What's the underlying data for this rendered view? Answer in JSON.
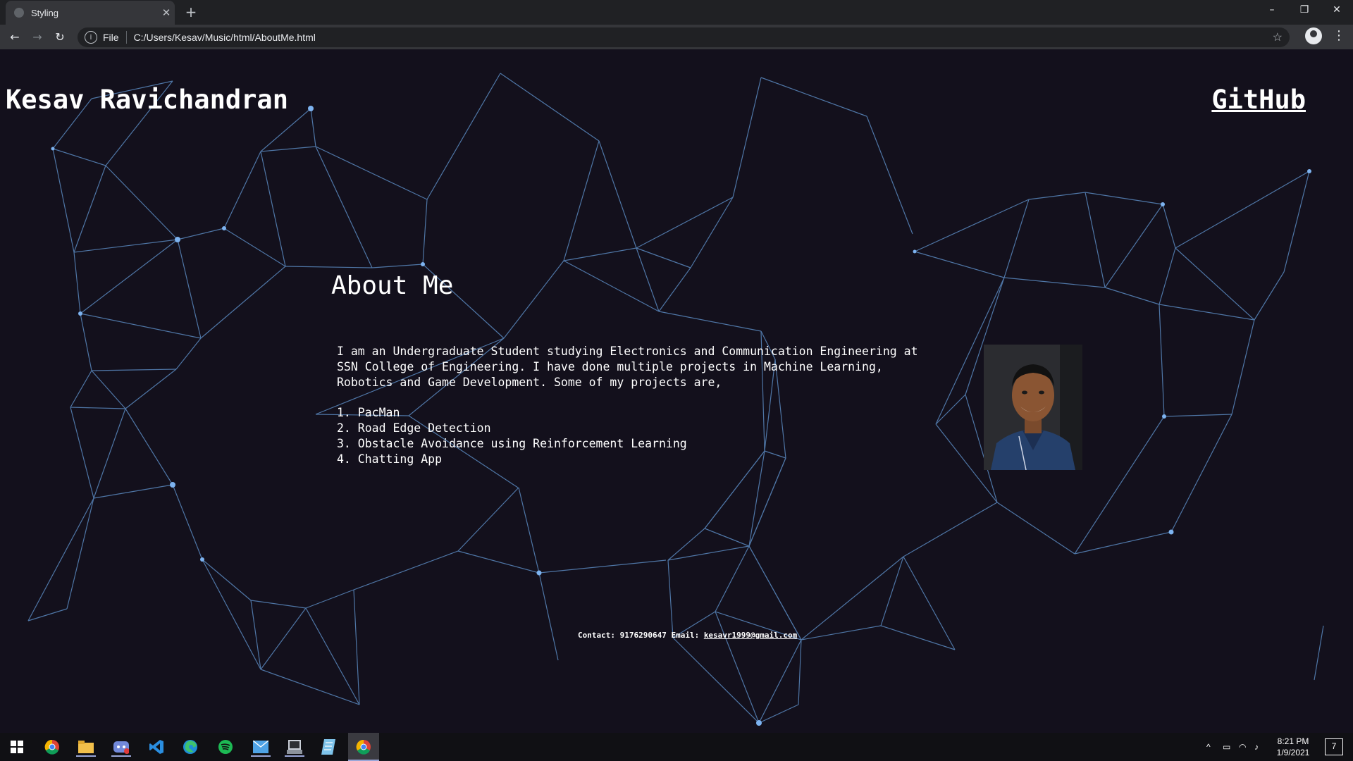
{
  "browser": {
    "tab_title": "Styling",
    "address_protocol": "File",
    "address_url": "C:/Users/Kesav/Music/html/AboutMe.html"
  },
  "page": {
    "name": "Kesav Ravichandran",
    "github_link": "GitHub",
    "heading": "About Me",
    "bio": "I am an Undergraduate Student studying Electronics and Communication Engineering at SSN College of Engineering. I have done multiple projects in Machine Learning, Robotics and Game Development. Some of my projects are,",
    "projects": [
      "1. PacMan",
      "2. Road Edge Detection",
      "3. Obstacle Avoidance using Reinforcement Learning",
      "4. Chatting App"
    ],
    "contact_label": "Contact: 9176290647 Email:",
    "email": "kesavr1999@gmail.com",
    "accent_color": "#6ea4e8"
  },
  "taskbar": {
    "time": "8:21 PM",
    "date": "1/9/2021",
    "notification_count": "7",
    "apps": [
      "windows-start-icon",
      "chrome-icon",
      "file-explorer-icon",
      "discord-icon",
      "vscode-icon",
      "edge-icon",
      "spotify-icon",
      "mail-icon",
      "terminal-icon",
      "notepad-icon",
      "chrome-active-icon"
    ]
  }
}
